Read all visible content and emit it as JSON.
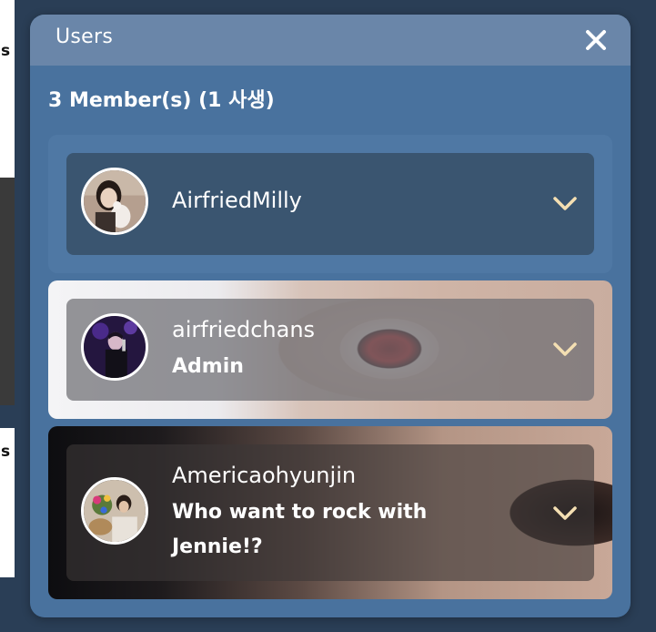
{
  "modal": {
    "title": "Users",
    "member_count": "3 Member(s) (1 사생)"
  },
  "background": {
    "letter_top": "s",
    "letter_bottom": "s"
  },
  "members": [
    {
      "username": "AirfriedMilly",
      "subtitle": ""
    },
    {
      "username": "airfriedchans",
      "subtitle": "Admin"
    },
    {
      "username": "Americaohyunjin",
      "subtitle": "Who want to rock with Jennie!?"
    }
  ],
  "colors": {
    "modal_bg": "#49729e",
    "header_bg": "#6a86a9",
    "chevron": "#f4dfb2"
  },
  "icons": {
    "close": "close-icon",
    "expand": "chevron-down-icon"
  }
}
